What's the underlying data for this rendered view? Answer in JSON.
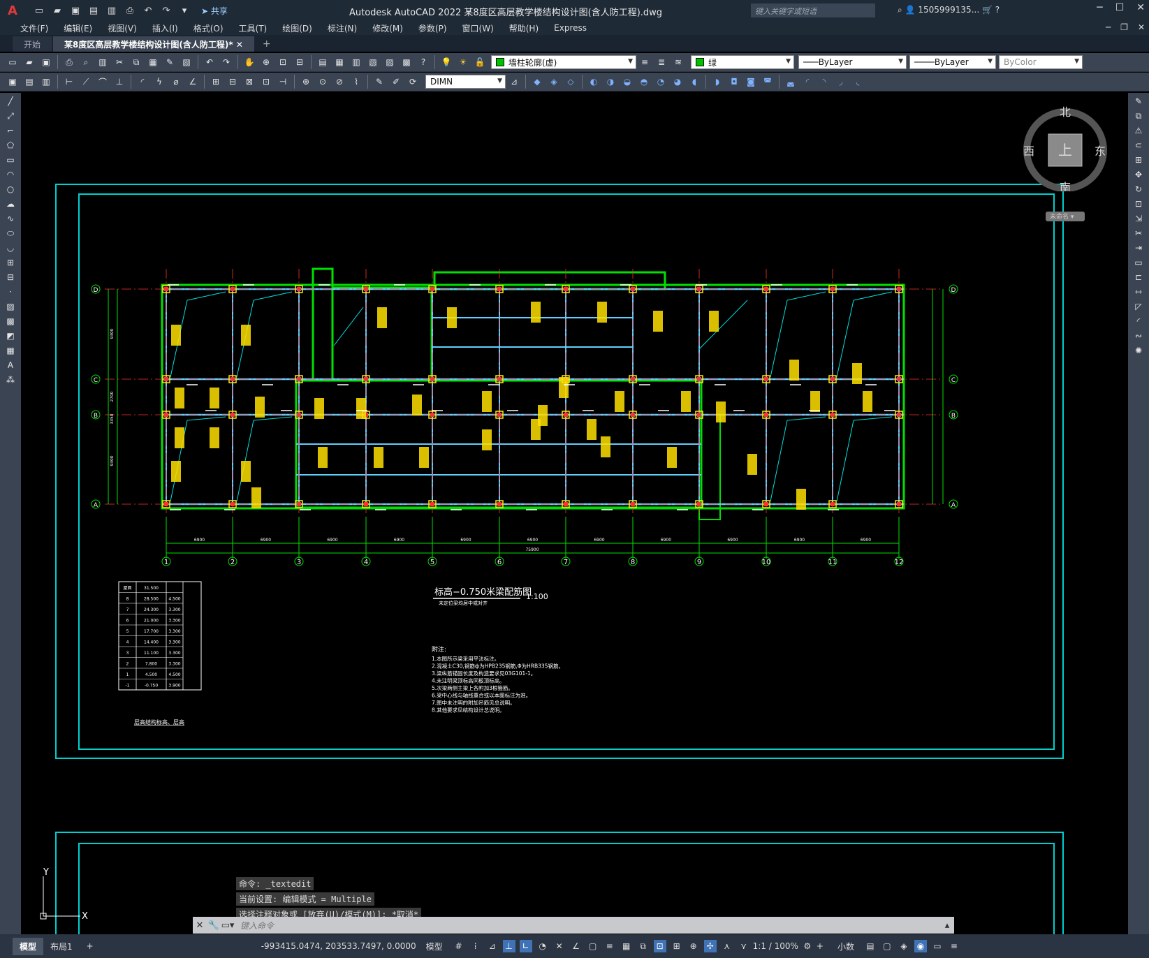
{
  "titlebar": {
    "logo": "A",
    "share_label": "共享",
    "title": "Autodesk AutoCAD 2022    某8度区高层教学楼结构设计图(含人防工程).dwg",
    "search_placeholder": "键入关键字或短语",
    "user": "1505999135...",
    "minimize": "─",
    "maximize": "☐",
    "close": "✕"
  },
  "menu": [
    "文件(F)",
    "编辑(E)",
    "视图(V)",
    "插入(I)",
    "格式(O)",
    "工具(T)",
    "绘图(D)",
    "标注(N)",
    "修改(M)",
    "参数(P)",
    "窗口(W)",
    "帮助(H)",
    "Express"
  ],
  "tabs": {
    "start": "开始",
    "active": "某8度区高层教学楼结构设计图(含人防工程)*",
    "plus": "+"
  },
  "toolbar": {
    "layer": "墙柱轮廓(虚)",
    "color": "绿",
    "linetype": "ByLayer",
    "lineweight": "ByLayer",
    "plotstyle": "ByColor",
    "dimstyle": "DIMN"
  },
  "compass": {
    "north": "北",
    "south": "南",
    "east": "东",
    "west": "西",
    "top": "上",
    "ucs_label": "未命名"
  },
  "drawing": {
    "plan_title": "标高−0.750米梁配筋图",
    "scale": "1:100",
    "subtitle": "未定位梁均居中或对齐",
    "notes_title": "附注:",
    "notes": [
      "1.本图所示梁采用平法标注。",
      "2.混凝土C30,钢筋ф为HPB235钢筋,Φ为HRB335钢筋。",
      "3.梁纵筋锚固长度及构造要求见03G101-1。",
      "4.未注明梁顶标高同板顶标高。",
      "5.次梁两侧主梁上各附加3根箍筋。",
      "6.梁中心线与轴线重合或以本图标注为准。",
      "7.图中未注明的附加吊筋见总说明。",
      "8.其他要求见结构设计总说明。"
    ],
    "axes_numbers": [
      "1",
      "2",
      "3",
      "4",
      "5",
      "6",
      "7",
      "8",
      "9",
      "10",
      "11",
      "12"
    ],
    "axes_letters": [
      "D",
      "C",
      "B",
      "A"
    ],
    "spans": [
      "6900",
      "6900",
      "6900",
      "6900",
      "6900",
      "6900",
      "6900",
      "6900",
      "6900",
      "6900",
      "6900"
    ],
    "total": "75900",
    "left_dims": [
      "9300",
      "2700",
      "3350",
      "9300"
    ],
    "table_title": "层高结构标高、层高",
    "table_rows": [
      [
        "屋面",
        "31.500",
        ""
      ],
      [
        "8",
        "28.500",
        "4.500"
      ],
      [
        "7",
        "24.300",
        "3.300"
      ],
      [
        "6",
        "21.000",
        "3.300"
      ],
      [
        "5",
        "17.700",
        "3.300"
      ],
      [
        "4",
        "14.400",
        "3.300"
      ],
      [
        "3",
        "11.100",
        "3.300"
      ],
      [
        "2",
        "7.800",
        "3.300"
      ],
      [
        "1",
        "4.500",
        "4.500"
      ],
      [
        "-1",
        "-0.750",
        "3.900"
      ]
    ]
  },
  "command": {
    "history": [
      "命令: _textedit",
      "当前设置: 编辑模式 = Multiple",
      "选择注释对象或 [放弃(U)/模式(M)]: *取消*"
    ],
    "placeholder": "键入命令"
  },
  "status": {
    "model_tab": "模型",
    "layout_tab": "布局1",
    "plus": "+",
    "coords": "-993415.0474, 203533.7497, 0.0000",
    "model": "模型",
    "scale": "1:1 / 100%",
    "units": "小数"
  },
  "ucs": {
    "x": "X",
    "y": "Y"
  }
}
